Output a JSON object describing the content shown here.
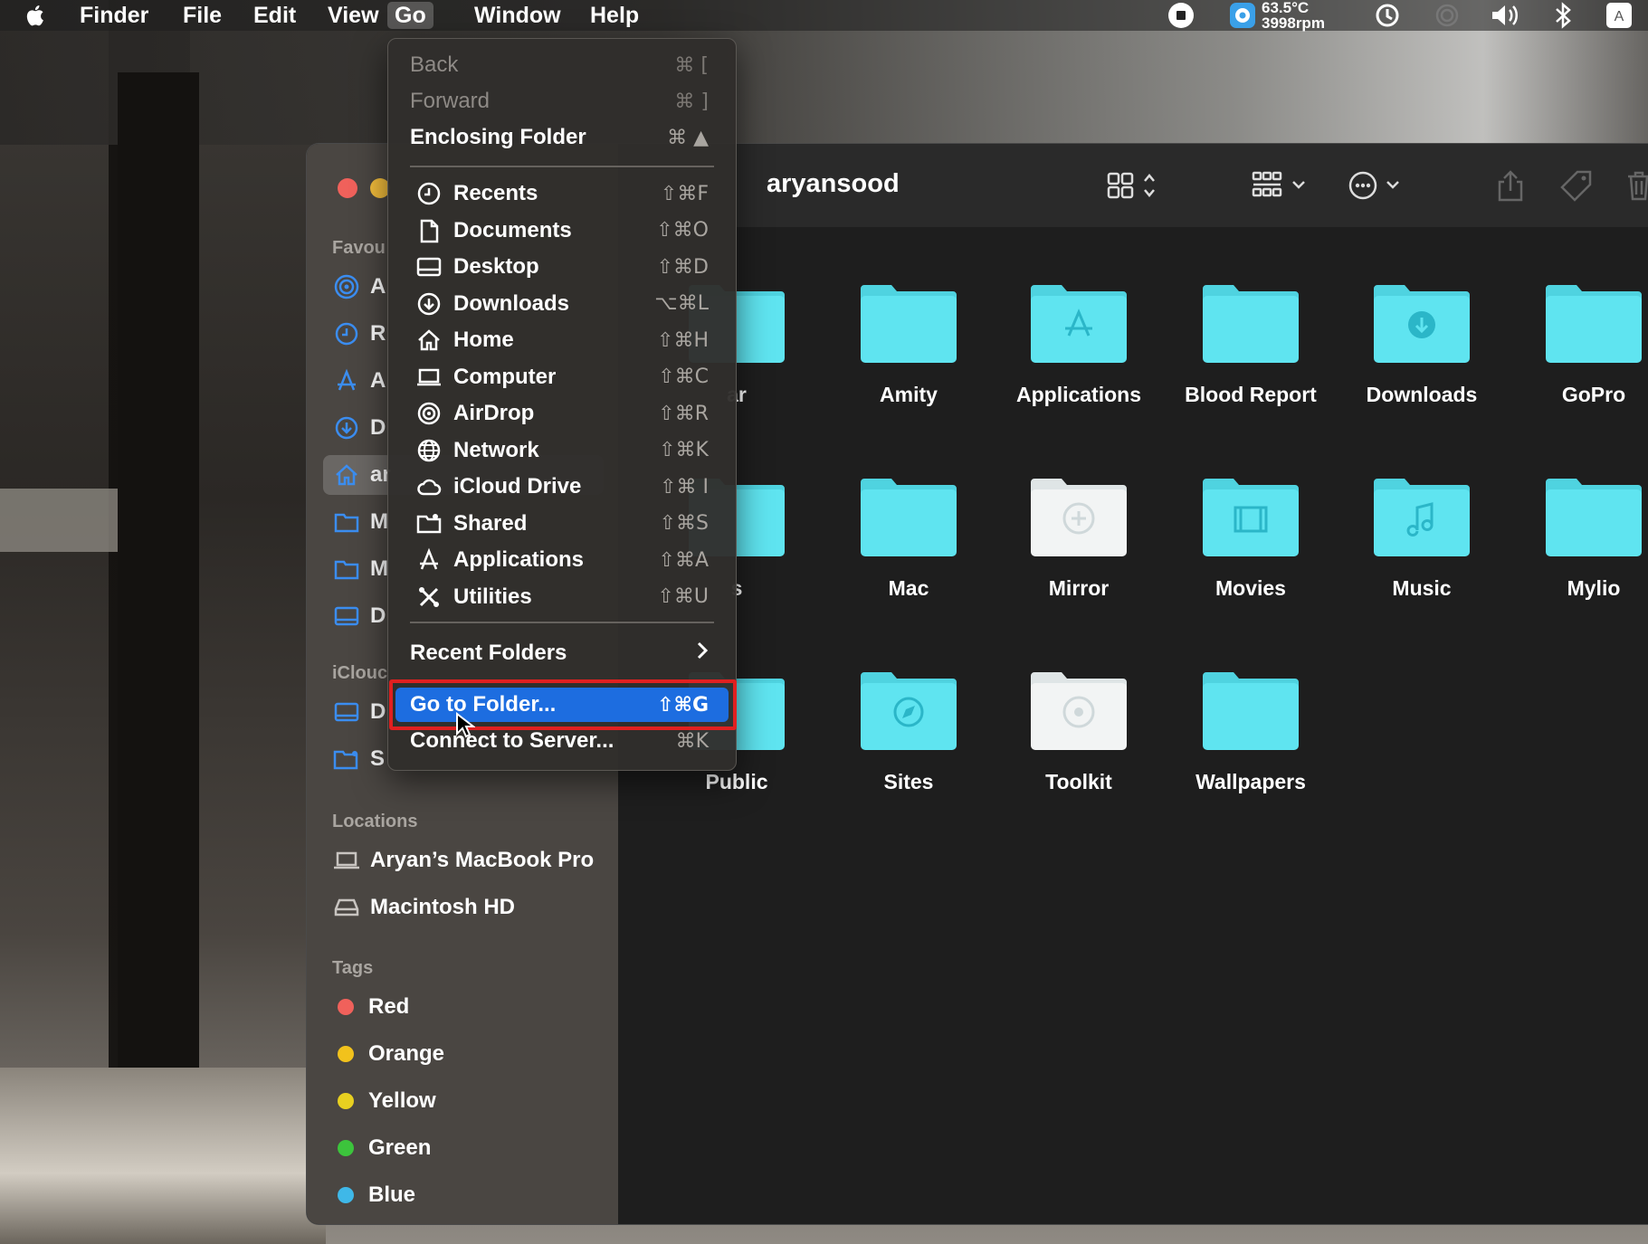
{
  "menubar": {
    "items": [
      "Finder",
      "File",
      "Edit",
      "View",
      "Go",
      "Window",
      "Help"
    ],
    "active": "Go",
    "status": {
      "temp_line1": "63.5°C",
      "temp_line2": "3998rpm"
    }
  },
  "go_menu": {
    "nav": [
      {
        "label": "Back",
        "shortcut": "⌘ [",
        "enabled": false
      },
      {
        "label": "Forward",
        "shortcut": "⌘ ]",
        "enabled": false
      },
      {
        "label": "Enclosing Folder",
        "shortcut": "⌘ ▲",
        "enabled": true
      }
    ],
    "places": [
      {
        "label": "Recents",
        "shortcut": "⇧⌘F",
        "icon": "clock-icon"
      },
      {
        "label": "Documents",
        "shortcut": "⇧⌘O",
        "icon": "document-icon"
      },
      {
        "label": "Desktop",
        "shortcut": "⇧⌘D",
        "icon": "desktop-icon"
      },
      {
        "label": "Downloads",
        "shortcut": "⌥⌘L",
        "icon": "download-icon"
      },
      {
        "label": "Home",
        "shortcut": "⇧⌘H",
        "icon": "home-icon"
      },
      {
        "label": "Computer",
        "shortcut": "⇧⌘C",
        "icon": "laptop-icon"
      },
      {
        "label": "AirDrop",
        "shortcut": "⇧⌘R",
        "icon": "airdrop-icon"
      },
      {
        "label": "Network",
        "shortcut": "⇧⌘K",
        "icon": "globe-icon"
      },
      {
        "label": "iCloud Drive",
        "shortcut": "⇧⌘ I",
        "icon": "cloud-icon"
      },
      {
        "label": "Shared",
        "shortcut": "⇧⌘S",
        "icon": "shared-folder-icon"
      },
      {
        "label": "Applications",
        "shortcut": "⇧⌘A",
        "icon": "applications-icon"
      },
      {
        "label": "Utilities",
        "shortcut": "⇧⌘U",
        "icon": "utilities-icon"
      }
    ],
    "recent_folders": "Recent Folders",
    "go_to_folder": {
      "label": "Go to Folder...",
      "shortcut": "⇧⌘G"
    },
    "connect": {
      "label": "Connect to Server...",
      "shortcut": "⌘K"
    }
  },
  "window": {
    "title": "aryansood",
    "sidebar": {
      "favourites_heading": "Favou",
      "favourites": [
        "A",
        "R",
        "A",
        "D",
        "ar",
        "M",
        "M",
        "D"
      ],
      "icloud_heading": "iClouc",
      "icloud": [
        "D",
        "S"
      ],
      "locations_heading": "Locations",
      "locations": [
        "Aryan’s MacBook Pro",
        "Macintosh HD"
      ],
      "tags_heading": "Tags",
      "tags": [
        {
          "label": "Red",
          "color": "#f0615b"
        },
        {
          "label": "Orange",
          "color": "#f2c21c"
        },
        {
          "label": "Yellow",
          "color": "#e8d020"
        },
        {
          "label": "Green",
          "color": "#3cc43c"
        },
        {
          "label": "Blue",
          "color": "#3fb8e8"
        }
      ]
    },
    "items": [
      {
        "name": "ar",
        "glyph": ""
      },
      {
        "name": "Amity",
        "glyph": ""
      },
      {
        "name": "Applications",
        "glyph": "apps"
      },
      {
        "name": "Blood Report",
        "glyph": ""
      },
      {
        "name": "Downloads",
        "glyph": "download"
      },
      {
        "name": "GoPro",
        "glyph": ""
      },
      {
        "name": "s",
        "glyph": ""
      },
      {
        "name": "Mac",
        "glyph": ""
      },
      {
        "name": "Mirror",
        "glyph": "mirror"
      },
      {
        "name": "Movies",
        "glyph": "film"
      },
      {
        "name": "Music",
        "glyph": "music"
      },
      {
        "name": "Mylio",
        "glyph": ""
      },
      {
        "name": "Public",
        "glyph": ""
      },
      {
        "name": "Sites",
        "glyph": "compass"
      },
      {
        "name": "Toolkit",
        "glyph": "disc"
      },
      {
        "name": "Wallpapers",
        "glyph": ""
      }
    ],
    "folder_color": "#5fe4f0"
  }
}
